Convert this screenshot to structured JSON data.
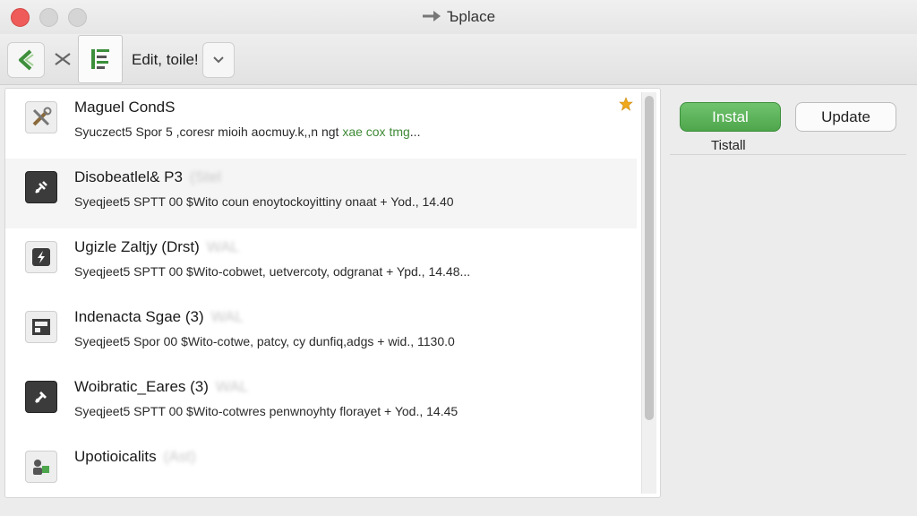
{
  "window": {
    "title": "Ъplace"
  },
  "toolbar": {
    "label": "Edit, toile!"
  },
  "list": {
    "items": [
      {
        "name": "Maguel CondS",
        "blur": "",
        "desc": "Syuczect5 Spor 5 ,coresr mioih aocmuy.k,,n ngt ",
        "desc_green": "xae cox tmg",
        "desc_tail": "...",
        "starred": true
      },
      {
        "name": "Disobeatlel& P3",
        "blur": "(Stel",
        "desc": "Syeqjeet5 SPTT 00 $Wito coun enoytockoyittiny onaat + Yod., 14.40",
        "desc_green": "",
        "desc_tail": "",
        "starred": false
      },
      {
        "name": "Ugizle Zaltjy (Drst)",
        "blur": "WAL",
        "desc": "Syeqjeet5 SPTT 00 $Wito-cobwet, uetvercoty, odgranat + Ypd., 14.48...",
        "desc_green": "",
        "desc_tail": "",
        "starred": false
      },
      {
        "name": "Indenacta Sgae (3)",
        "blur": "WAL",
        "desc": "Syeqjeet5 Spor 00 $Wito-cotwe, patcy, cy dunfiq,adgs + wid., 1130.0",
        "desc_green": "",
        "desc_tail": "",
        "starred": false
      },
      {
        "name": "Woibratic_Eares (3)",
        "blur": "WAL",
        "desc": "Syeqjeet5 SPTT 00 $Wito-cotwres penwnoyhty florayet + Yod., 14.45",
        "desc_green": "",
        "desc_tail": "",
        "starred": false
      },
      {
        "name": "Upotioicalits",
        "blur": "(Ast)",
        "desc": "",
        "desc_green": "",
        "desc_tail": "",
        "starred": false
      }
    ]
  },
  "actions": {
    "install_label": "Instal",
    "update_label": "Update",
    "install_caption": "Tistall"
  },
  "colors": {
    "accent_green": "#5bb459",
    "star": "#f0a81c",
    "close": "#ee5b58"
  }
}
